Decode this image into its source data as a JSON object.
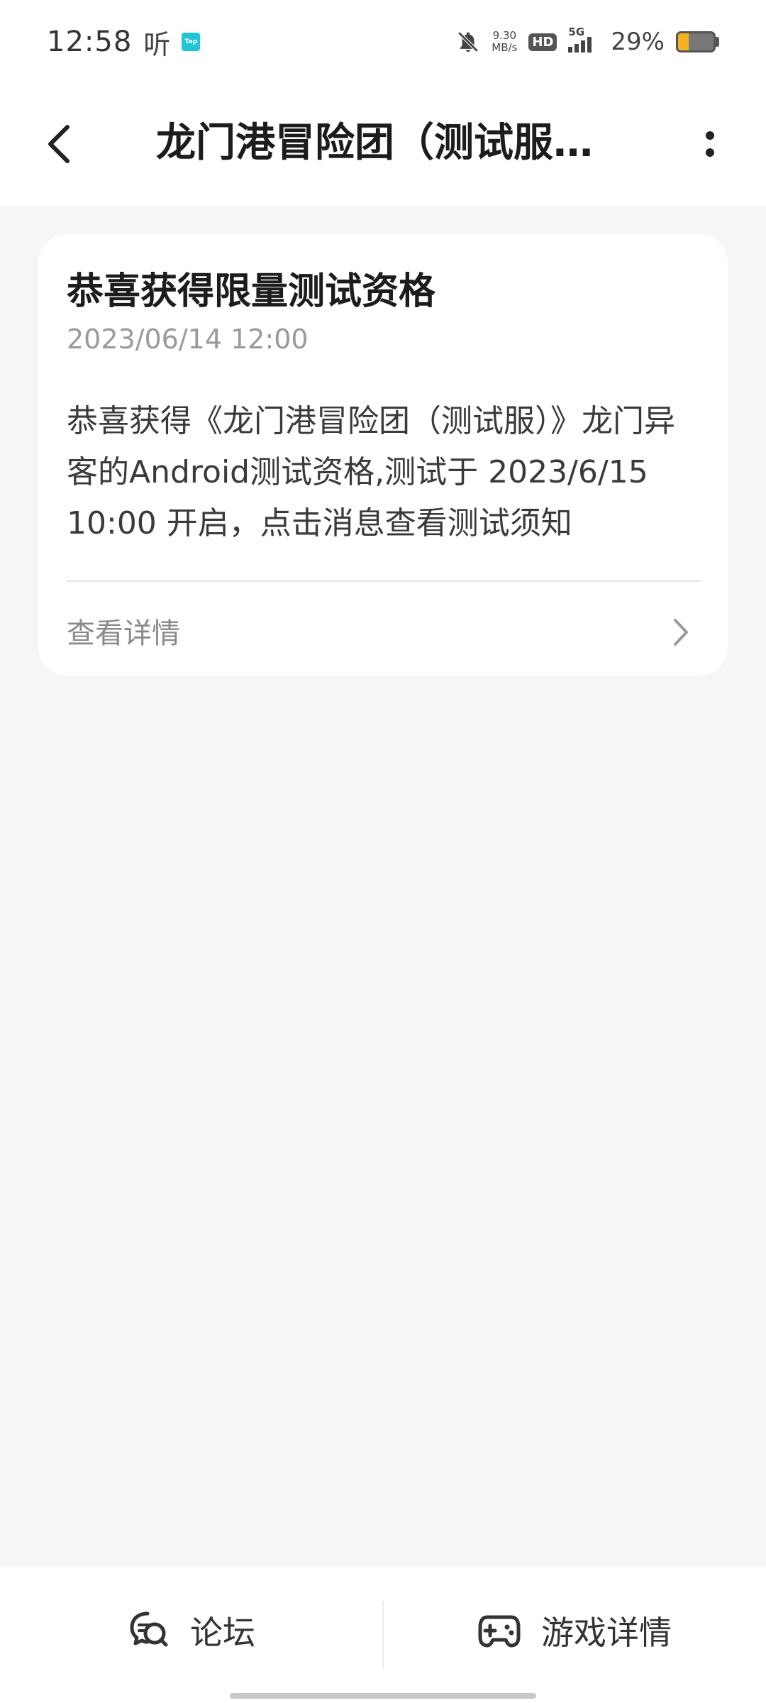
{
  "status_bar": {
    "time": "12:58",
    "ting": "听",
    "app_badge": "Tap",
    "speed_value": "9.30",
    "speed_unit": "MB/s",
    "hd": "HD",
    "network": "5G",
    "battery_percent": "29%",
    "battery_level": 0.29,
    "battery_color": "#f5b323"
  },
  "header": {
    "title": "龙门港冒险团（测试服…"
  },
  "message": {
    "title": "恭喜获得限量测试资格",
    "time": "2023/06/14 12:00",
    "body": "恭喜获得《龙门港冒险团（测试服）》龙门异客的Android测试资格,测试于 2023/6/15 10:00 开启，点击消息查看测试须知",
    "link_label": "查看详情"
  },
  "bottom_nav": {
    "forum_label": "论坛",
    "game_details_label": "游戏详情"
  }
}
